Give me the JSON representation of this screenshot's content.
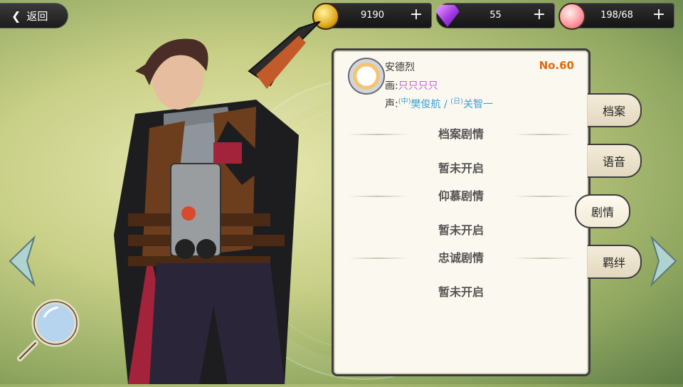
{
  "nav": {
    "back_label": "返回"
  },
  "resources": {
    "gold": {
      "value": "9190",
      "icon": "gold-coin-icon"
    },
    "gem": {
      "value": "55",
      "icon": "gem-icon"
    },
    "peach": {
      "value": "198/68",
      "icon": "peach-icon"
    }
  },
  "profile": {
    "name": "安德烈",
    "number": "No.60",
    "artist_label": "画:",
    "artist": "只只只只",
    "voice_label": "声:",
    "voice_cn_tag": "(中)",
    "voice_cn": "樊俊航",
    "voice_sep": " / ",
    "voice_jp_tag": "(日)",
    "voice_jp": "关智一"
  },
  "stories": [
    {
      "title": "档案剧情",
      "status": "暂未开启"
    },
    {
      "title": "仰慕剧情",
      "status": "暂未开启"
    },
    {
      "title": "忠诚剧情",
      "status": "暂未开启"
    }
  ],
  "tabs": [
    {
      "label": "档案"
    },
    {
      "label": "语音"
    },
    {
      "label": "剧情"
    },
    {
      "label": "羁绊"
    }
  ],
  "colors": {
    "number": "#e06a10",
    "artist": "#c060e0",
    "voice": "#3aa0d8"
  }
}
